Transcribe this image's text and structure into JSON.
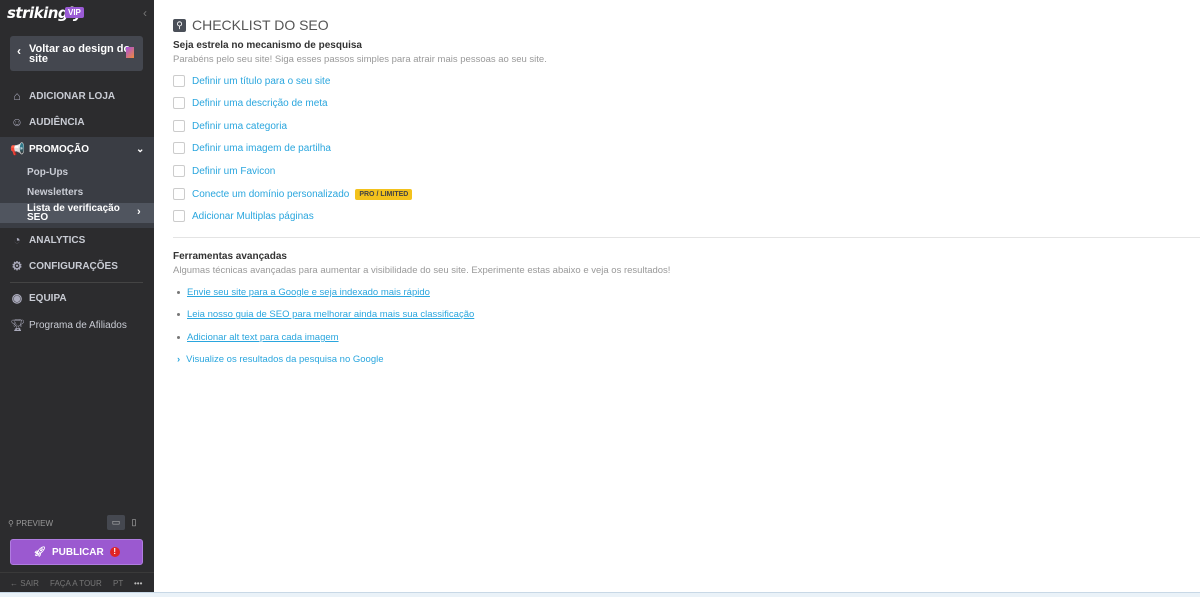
{
  "sidebar": {
    "logo": "strikingly",
    "vip": "VIP",
    "back_label": "Voltar ao design do site",
    "items": [
      {
        "label": "ADICIONAR LOJA",
        "icon": "store-icon"
      },
      {
        "label": "AUDIÊNCIA",
        "icon": "audience-icon"
      },
      {
        "label": "PROMOÇÃO",
        "icon": "megaphone-icon"
      },
      {
        "label": "ANALYTICS",
        "icon": "pie-chart-icon"
      },
      {
        "label": "CONFIGURAÇÕES",
        "icon": "gear-icon"
      },
      {
        "label": "EQUIPA",
        "icon": "team-icon"
      },
      {
        "label": "Programa de Afiliados",
        "icon": "trophy-icon"
      }
    ],
    "promo_sub": [
      "Pop-Ups",
      "Newsletters",
      "Lista de verificação SEO"
    ],
    "preview": "PREVIEW",
    "publish": "PUBLICAR",
    "footer": {
      "exit": "SAIR",
      "tour": "FAÇA A TOUR",
      "lang": "PT",
      "more": "•••"
    }
  },
  "main": {
    "title": "CHECKLIST DO SEO",
    "section1": {
      "heading": "Seja estrela no mecanismo de pesquisa",
      "desc": "Parabéns pelo seu site! Siga esses passos simples para atrair mais pessoas ao seu site.",
      "items": [
        "Definir um título para o seu site",
        "Definir uma descrição de meta",
        "Definir uma categoria",
        "Definir uma imagem de partilha",
        "Definir um Favicon",
        "Conecte um domínio personalizado",
        "Adicionar Multiplas páginas"
      ],
      "badge": "PRO / LIMITED"
    },
    "section2": {
      "heading": "Ferramentas avançadas",
      "desc": "Algumas técnicas avançadas para aumentar a visibilidade do seu site. Experimente estas abaixo e veja os resultados!",
      "links": [
        "Envie seu site para a Google e seja indexado mais rápido",
        "Leia nosso guia de SEO para melhorar ainda mais sua classificação",
        "Adicionar alt text para cada imagem"
      ],
      "preview_link": "Visualize os resultados da pesquisa no Google"
    }
  },
  "colors": {
    "sidebar": "#2c2c2e",
    "accent": "#9b59d0",
    "link": "#2aa6de",
    "badge": "#f3c21c"
  }
}
